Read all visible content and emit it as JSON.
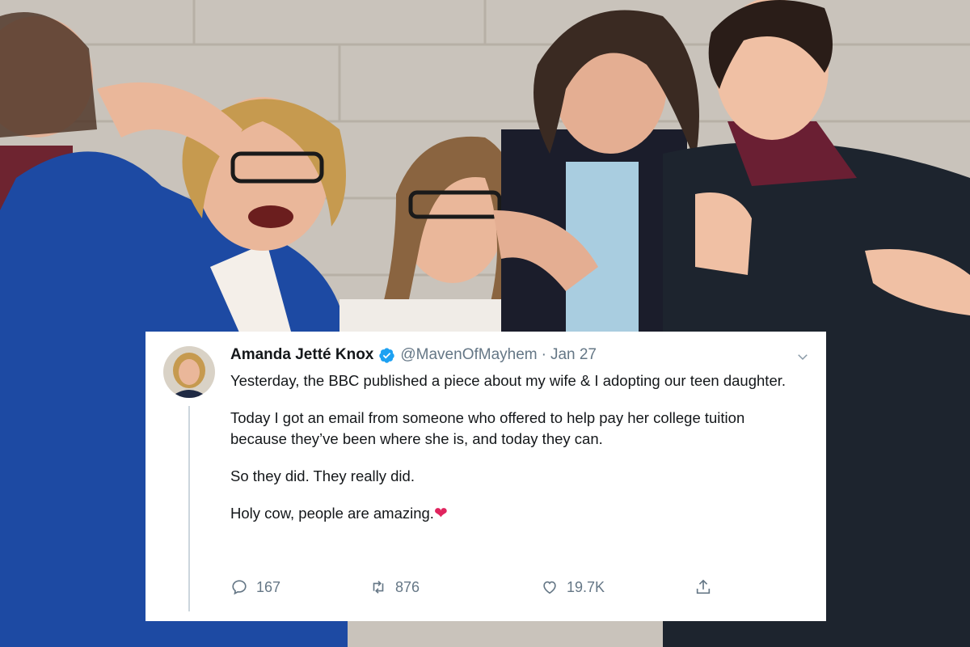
{
  "tweet": {
    "display_name": "Amanda Jetté Knox",
    "handle": "@MavenOfMayhem",
    "separator": "·",
    "date": "Jan 27",
    "paragraphs": [
      "Yesterday, the BBC published a piece about my wife & I adopting our teen daughter.",
      "Today I got an email from someone who offered to help pay her college tuition because they’ve been where she is, and today they can.",
      "So they did. They really did.",
      "Holy cow, people are amazing."
    ],
    "emoji": "❤",
    "stats": {
      "replies": "167",
      "retweets": "876",
      "likes": "19.7K"
    },
    "icons": {
      "verified": "verified-badge-icon",
      "menu": "chevron-down-icon",
      "reply": "reply-icon",
      "retweet": "retweet-icon",
      "like": "heart-icon",
      "share": "share-icon"
    },
    "colors": {
      "verified": "#1da1f2",
      "heart_emoji": "#e0245e",
      "meta": "#657786",
      "text": "#14171a"
    }
  }
}
